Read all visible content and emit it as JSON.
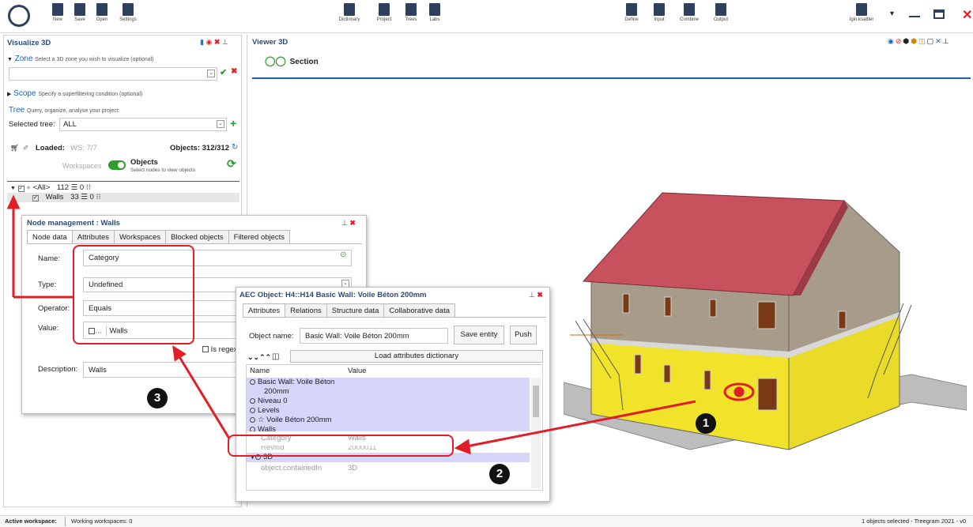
{
  "toolbar": {
    "left": [
      "New",
      "Save",
      "Open",
      "Settings"
    ],
    "center": [
      "Dictionary",
      "Project",
      "Trees",
      "Labs"
    ],
    "right": [
      "Define",
      "Input",
      "Combine",
      "Output"
    ],
    "user": "tgin.ksattler"
  },
  "left": {
    "title": "Visualize 3D",
    "zone_label": "Zone",
    "zone_hint": "Select a 3D zone you wish to visualize (optional)",
    "scope_label": "Scope",
    "scope_hint": "Specify a superfiltering condition (optional)",
    "tree_label": "Tree",
    "tree_hint": "Query, organize, analyse your project",
    "selected_tree_label": "Selected tree:",
    "selected_tree_value": "ALL",
    "loaded_label": "Loaded:",
    "loaded_value": "WS: 7/7",
    "objects_count": "Objects: 312/312",
    "workspaces_label": "Workspaces",
    "objects_label": "Objects",
    "objects_hint": "Select nodes to view objects",
    "tree_all": "<All>",
    "tree_all_counts": "112 ☰ 0 ⁝⁝",
    "tree_walls": "Walls",
    "tree_walls_counts": "33 ☰ 0 ⁝⁝"
  },
  "viewer": {
    "title": "Viewer 3D",
    "section": "Section"
  },
  "node": {
    "title": "Node management : Walls",
    "tabs": [
      "Node data",
      "Attributes",
      "Workspaces",
      "Blocked objects",
      "Filtered objects"
    ],
    "name_label": "Name:",
    "name_value": "Category",
    "type_label": "Type:",
    "type_value": "Undefined",
    "operator_label": "Operator:",
    "operator_value": "Equals",
    "value_label": "Value:",
    "value_prefix": "…",
    "value_value": "Walls",
    "regex_label": "Is regex",
    "desc_label": "Description:",
    "desc_value": "Walls"
  },
  "aec": {
    "title": "AEC Object: H4::H14 Basic Wall: Voile Béton 200mm",
    "tabs": [
      "Attributes",
      "Relations",
      "Structure data",
      "Collaborative data"
    ],
    "object_name_label": "Object name:",
    "object_name_value": "Basic Wall: Voile Béton 200mm",
    "save_label": "Save entity",
    "push_label": "Push",
    "load_label": "Load attributes dictionary",
    "col_name": "Name",
    "col_value": "Value",
    "rows": [
      {
        "name": "Basic Wall: Voile Béton",
        "value": ""
      },
      {
        "name": "200mm",
        "value": ""
      },
      {
        "name": "Niveau 0",
        "value": ""
      },
      {
        "name": "Levels",
        "value": ""
      },
      {
        "name": "Voile Béton 200mm",
        "value": ""
      },
      {
        "name": "Walls",
        "value": ""
      },
      {
        "name": "Category",
        "value": "Walls"
      },
      {
        "name": "RevitId",
        "value": "2000011"
      },
      {
        "name": "3D",
        "value": ""
      },
      {
        "name": "object.containedIn",
        "value": "3D"
      }
    ]
  },
  "status": {
    "active": "Active workspace:",
    "working": "Working workspaces: 0",
    "right": "1 objects selected - Treegram 2021 - v0"
  },
  "callouts": [
    "1",
    "2",
    "3"
  ],
  "colors": {
    "accent": "#1565c0",
    "red": "#e11d26",
    "select": "#d6d6fb"
  }
}
